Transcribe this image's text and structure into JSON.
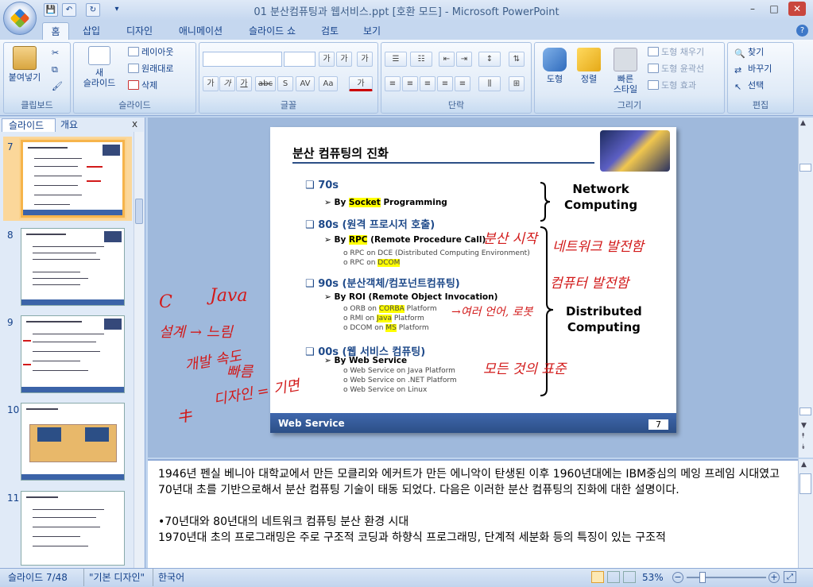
{
  "window": {
    "title": "01 분산컴퓨팅과 웹서비스.ppt [호환 모드] - Microsoft PowerPoint",
    "minimize": "–",
    "maximize": "□",
    "close": "✕"
  },
  "qat": {
    "save": "💾",
    "undo": "↶",
    "redo": "↻",
    "customize": "▾"
  },
  "tabs": [
    "홈",
    "삽입",
    "디자인",
    "애니메이션",
    "슬라이드 쇼",
    "검토",
    "보기"
  ],
  "ribbon": {
    "clipboard": {
      "label": "클립보드",
      "paste": "붙여넣기"
    },
    "slides": {
      "label": "슬라이드",
      "new_slide_line1": "새",
      "new_slide_line2": "슬라이드",
      "layout": "레이아웃",
      "reset": "원래대로",
      "delete": "삭제"
    },
    "font": {
      "label": "글꼴",
      "font_name": "",
      "font_size": "",
      "grow": "가",
      "shrink": "가",
      "clear": "가",
      "bold": "가",
      "italic": "가",
      "underline": "가",
      "strike": "abc",
      "shadow": "S",
      "spacing": "AV",
      "case": "Aa",
      "color": "가"
    },
    "paragraph": {
      "label": "단락"
    },
    "drawing": {
      "label": "그리기",
      "shapes": "도형",
      "arrange": "정렬",
      "quick_styles_line1": "빠른",
      "quick_styles_line2": "스타일",
      "fill": "도형 채우기",
      "outline": "도형 윤곽선",
      "effects": "도형 효과"
    },
    "editing": {
      "label": "편집",
      "find": "찾기",
      "replace": "바꾸기",
      "select": "선택"
    }
  },
  "panel": {
    "tab_slides": "슬라이드",
    "tab_outline": "개요",
    "close": "x"
  },
  "thumbnails": [
    {
      "num": "7",
      "selected": true
    },
    {
      "num": "8",
      "selected": false
    },
    {
      "num": "9",
      "selected": false
    },
    {
      "num": "10",
      "selected": false
    },
    {
      "num": "11",
      "selected": false
    }
  ],
  "slide": {
    "title": "분산 컴퓨팅의 진화",
    "footer": "Web Service",
    "page": "7",
    "items": [
      {
        "kind": "h",
        "text": "70s"
      },
      {
        "kind": "sub",
        "pre": "By ",
        "hl": "Socket",
        "post": " Programming"
      },
      {
        "kind": "h",
        "text": "80s (원격 프로시저 호출)"
      },
      {
        "kind": "sub",
        "pre": "By ",
        "hl": "RPC",
        "post": " (Remote Procedure Call)"
      },
      {
        "kind": "det",
        "pre": "RPC on DCE (Distributed Computing Environment)",
        "hl": "",
        "post": ""
      },
      {
        "kind": "det",
        "pre": "RPC on ",
        "hl": "DCOM",
        "post": ""
      },
      {
        "kind": "h",
        "text": "90s (분산객체/컴포넌트컴퓨팅)"
      },
      {
        "kind": "sub",
        "pre": "By RO",
        "hl": "",
        "post": "I (Remote Object Invocation)"
      },
      {
        "kind": "det",
        "pre": "ORB on ",
        "hl": "CORBA",
        "post": " Platform"
      },
      {
        "kind": "det",
        "pre": "RMI on ",
        "hl": "Java",
        "post": " Platform"
      },
      {
        "kind": "det",
        "pre": "DCOM on ",
        "hl": "MS",
        "post": " Platform"
      },
      {
        "kind": "h",
        "text": "00s (웹 서비스 컴퓨팅)"
      },
      {
        "kind": "sub",
        "pre": "By Web Service",
        "hl": "",
        "post": ""
      },
      {
        "kind": "det",
        "pre": "Web Service on Java Platform",
        "hl": "",
        "post": ""
      },
      {
        "kind": "det",
        "pre": "Web Service on .NET Platform",
        "hl": "",
        "post": ""
      },
      {
        "kind": "det",
        "pre": "Web Service on Linux",
        "hl": "",
        "post": ""
      }
    ],
    "network_computing": "Network\nComputing",
    "distributed_computing": "Distributed\nComputing"
  },
  "annotations": {
    "slide": [
      "분산 시작",
      "네트워크 발전함",
      "컴퓨터 발전함",
      "→여러 언어, 로봇",
      "모든 것의 표준"
    ],
    "margin": [
      "C",
      "Java",
      "설계 → 느림",
      "개발 속도",
      "빠름",
      "디자인 = 기면",
      "キ"
    ]
  },
  "notes": [
    "1946년 펜실 베니아 대학교에서 만든 모클리와 에커트가 만든 에니악이 탄생된 이후 1960년대에는 IBM중심의 메잉 프레임 시대였고",
    " 70년대 초를 기반으로해서 분산 컴퓨팅 기술이 태동 되었다. 다음은 이러한 분산 컴퓨팅의 진화에 대한 설명이다.",
    "",
    "•70년대와 80년대의 네트워크 컴퓨팅 분산 환경 시대",
    "1970년대 초의 프로그래밍은 주로 구조적 코딩과 하향식 프로그래밍, 단계적 세분화 등의 특징이 있는 구조적"
  ],
  "status": {
    "slide_info": "슬라이드 7/48",
    "theme": "\"기본 디자인\"",
    "language": "한국어",
    "zoom": "53%"
  }
}
